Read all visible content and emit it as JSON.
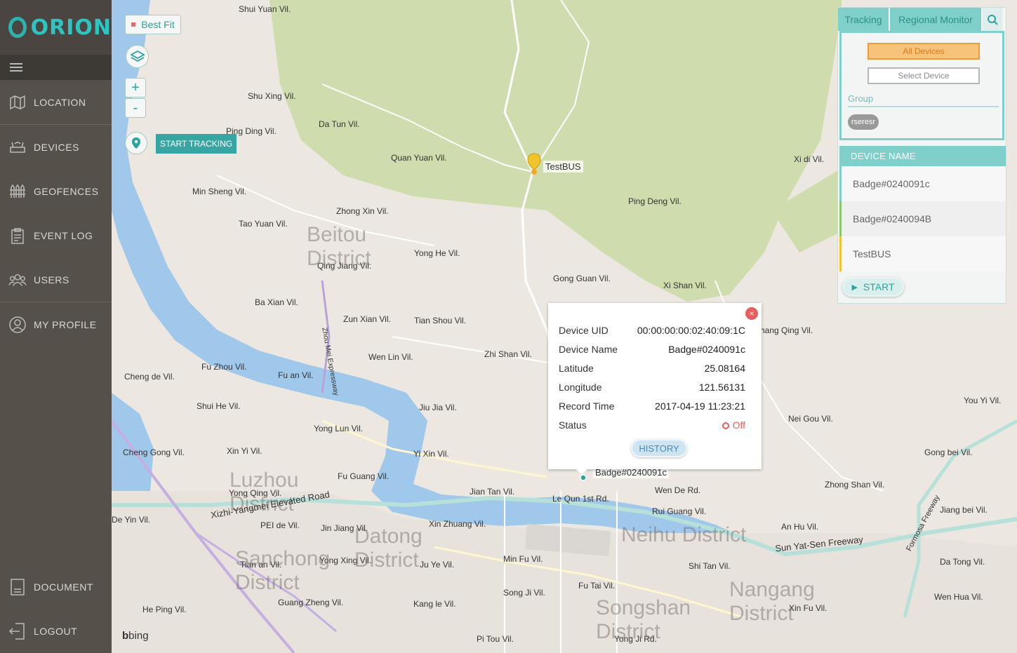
{
  "app": {
    "logo_text": "ORION"
  },
  "sidebar": {
    "items": [
      {
        "label": "LOCATION",
        "icon": "map-icon"
      },
      {
        "label": "DEVICES",
        "icon": "router-icon"
      },
      {
        "label": "GEOFENCES",
        "icon": "fence-icon"
      },
      {
        "label": "EVENT LOG",
        "icon": "clipboard-icon"
      },
      {
        "label": "USERS",
        "icon": "users-icon"
      },
      {
        "label": "MY PROFILE",
        "icon": "user-icon"
      }
    ],
    "bottom": [
      {
        "label": "DOCUMENT",
        "icon": "document-icon"
      },
      {
        "label": "LOGOUT",
        "icon": "logout-icon"
      }
    ]
  },
  "map": {
    "best_fit": "Best Fit",
    "zoom_in": "+",
    "zoom_out": "-",
    "start_tracking": "START TRACKING",
    "attribution": "bing",
    "labels": [
      "Shui Yuan Vil.",
      "Shu Xing Vil.",
      "Ping Ding Vil.",
      "Da Tun Vil.",
      "Quan Yuan Vil.",
      "Min Sheng Vil.",
      "Zhong Xin Vil.",
      "Tao Yuan Vil.",
      "Qing Jiang Vil.",
      "Yong He Vil.",
      "Ping Deng Vil.",
      "Xi di Vil.",
      "Gong Guan Vil.",
      "Xi Shan Vil.",
      "Ba Xian Vil.",
      "Zun Xian Vil.",
      "Tian Shou Vil.",
      "Fu Zhou Vil.",
      "Fu an Vil.",
      "Wen Lin Vil.",
      "Zhi Shan Vil.",
      "Cheng de Vil.",
      "Shui He Vil.",
      "Jiu Jia Vil.",
      "Yong Lun Vil.",
      "Cheng Gong Vil.",
      "Xin Yi Vil.",
      "Yi Xin Vil.",
      "Fu Guang Vil.",
      "Yong Qing Vil.",
      "Jian Tan Vil.",
      "Le Qun 1st Rd.",
      "Wen De Rd.",
      "Rui Guang Vil.",
      "Xin Zhuang Vil.",
      "PEI de Vil.",
      "Jin Jiang Vil.",
      "Min Fu Vil.",
      "Tian an Vil.",
      "Yong Xing Vil.",
      "Ju Ye Vil.",
      "Fu Tai Vil.",
      "Shi Tan Vil.",
      "An Hu Vil.",
      "Song Ji Vil.",
      "Kang le Vil.",
      "Guang Zheng Vil.",
      "He Ping Vil.",
      "Xin Fu Vil.",
      "Wen Hua Vil.",
      "Da Tong Vil.",
      "Jiang bei Vil.",
      "Gong bei Vil.",
      "Zhong Shan Vil.",
      "Nei Gou Vil.",
      "You Yi Vil.",
      "hang Qing Vil.",
      "De Yin Vil.",
      "Yong Ji Rd.",
      "Pi Tou Vil."
    ],
    "districts": [
      "Beitou District",
      "Luzhou District",
      "Datong District",
      "Sanchong District",
      "Neihu District",
      "Songshan District",
      "Nangang District"
    ],
    "road_names": [
      "Xizhi-Yangmei Elevated Road",
      "Sun Yat-Sen Freeway",
      "Formosa Freeway",
      "Zhou Mei Expressway"
    ],
    "markers": [
      {
        "label": "TestBUS",
        "color": "#f0c52b"
      },
      {
        "label": "Badge#0240091c",
        "color": "#2aa39f"
      }
    ]
  },
  "panel": {
    "tabs": [
      {
        "label": "Tracking"
      },
      {
        "label": "Regional Monitor"
      }
    ],
    "search_icon": "search-icon",
    "btn_all_devices": "All Devices",
    "btn_select_device": "Select Device",
    "group_label": "Group",
    "group_chip": "rseresr",
    "device_header": "DEVICE NAME",
    "devices": [
      "Badge#0240091c",
      "Badge#0240094B",
      "TestBUS"
    ],
    "start_label": "START"
  },
  "popup": {
    "rows": [
      {
        "key": "Device UID",
        "value": "00:00:00:00:02:40:09:1C"
      },
      {
        "key": "Device Name",
        "value": "Badge#0240091c"
      },
      {
        "key": "Latitude",
        "value": "25.08164"
      },
      {
        "key": "Longitude",
        "value": "121.56131"
      },
      {
        "key": "Record Time",
        "value": "2017-04-19 11:23:21"
      }
    ],
    "status_key": "Status",
    "status_value": "Off",
    "history": "HISTORY",
    "close": "×"
  },
  "colors": {
    "accent": "#2aa39f",
    "panel_tab": "#7fd0cb",
    "status_off": "#e85c5c",
    "sidebar": "#55504a"
  }
}
